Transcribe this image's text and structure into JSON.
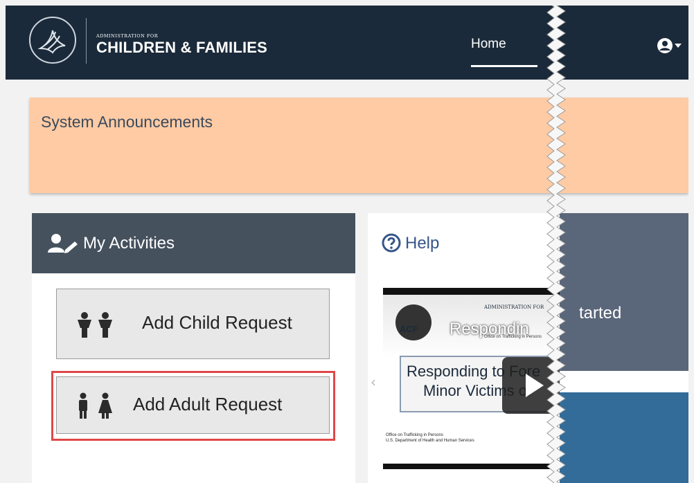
{
  "header": {
    "brand_top": "ADMINISTRATION FOR",
    "brand_main": "CHILDREN & FAMILIES",
    "nav_home": "Home",
    "user_icon": "user-circle-icon",
    "colors": {
      "bar": "#1b2a3a",
      "text": "#ffffff"
    }
  },
  "announcements": {
    "title": "System Announcements",
    "color": "#ffcba4"
  },
  "activities": {
    "title": "My Activities",
    "icon": "user-edit-icon",
    "add_child": "Add Child Request",
    "add_child_icon": "children-icon",
    "add_adult": "Add Adult Request",
    "add_adult_icon": "adults-icon",
    "highlight_color": "#e04848"
  },
  "help": {
    "title": "Help",
    "icon": "question-circle-icon",
    "video": {
      "logo_mark": "ACF",
      "logo_small": "ADMINISTRATION FOR",
      "logo_sub": "Office on Trafficking in Persons",
      "overlay_title": "Respondin",
      "slide_line1": "Responding to Fore",
      "slide_line2": "Minor Victims of",
      "footer_line1": "Office on Trafficking in Persons",
      "footer_line2": "U.S. Department of Health and Human Services",
      "play_icon": "play-icon"
    }
  },
  "side_panel": {
    "label": "tarted",
    "color": "#5a6679",
    "blue": "#336c99"
  }
}
